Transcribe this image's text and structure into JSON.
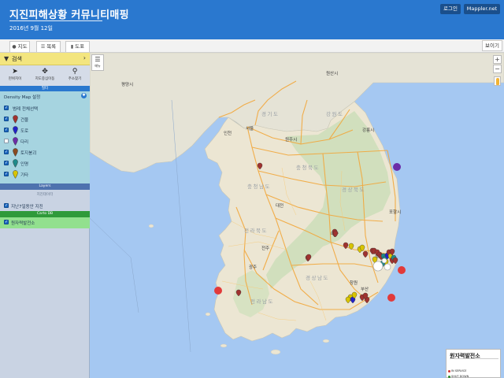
{
  "header": {
    "title": "지진피해상황 커뮤니티매핑",
    "date": "2016년 9월 12일",
    "login_label": "로그인",
    "brand_label": "Mappler.net"
  },
  "tabs": [
    {
      "label": "지도",
      "icon": "map-marker-icon"
    },
    {
      "label": "목록",
      "icon": "list-icon"
    },
    {
      "label": "도표",
      "icon": "bar-chart-icon"
    }
  ],
  "view_label": "보이기",
  "sidebar": {
    "search_label": "검색",
    "tools": [
      {
        "label": "현위치이",
        "icon": "locate-arrow-icon"
      },
      {
        "label": "지도중심이동",
        "icon": "crosshair-icon"
      },
      {
        "label": "주소찾기",
        "icon": "magnifier-icon"
      }
    ],
    "section_label": "필터",
    "density_label": "Density Map 설정",
    "categories": [
      {
        "label": "범례 전체선택",
        "checked": true,
        "color": null
      },
      {
        "label": "건물",
        "checked": true,
        "color": "#a0322f"
      },
      {
        "label": "도로",
        "checked": true,
        "color": "#2222c8"
      },
      {
        "label": "다리",
        "checked": false,
        "color": "#6b2ca8"
      },
      {
        "label": "토지붕괴",
        "checked": true,
        "color": "#8a4a20"
      },
      {
        "label": "인명",
        "checked": true,
        "color": "#1f8a8a"
      },
      {
        "label": "기타",
        "checked": true,
        "color": "#d8c400"
      }
    ],
    "layers_label": "Layers",
    "layers_sub": "지진데이터",
    "layer_item": "지난7일동안 지진",
    "carto_label": "Carto DB",
    "carto_item": "원자력발전소"
  },
  "map": {
    "menu_label": "메뉴",
    "zoom_in": "+",
    "zoom_out": "−",
    "labels": [
      {
        "text": "평양시",
        "kind": "city"
      },
      {
        "text": "원산시",
        "kind": "city"
      },
      {
        "text": "서울",
        "kind": "city"
      },
      {
        "text": "인천",
        "kind": "city"
      },
      {
        "text": "경기도",
        "kind": "province"
      },
      {
        "text": "강원도",
        "kind": "province"
      },
      {
        "text": "충청북도",
        "kind": "province"
      },
      {
        "text": "충청남도",
        "kind": "province"
      },
      {
        "text": "대전",
        "kind": "city"
      },
      {
        "text": "경상북도",
        "kind": "province"
      },
      {
        "text": "전라북도",
        "kind": "province"
      },
      {
        "text": "대구",
        "kind": "city"
      },
      {
        "text": "광주",
        "kind": "city"
      },
      {
        "text": "울산",
        "kind": "city"
      },
      {
        "text": "경상남도",
        "kind": "province"
      },
      {
        "text": "부산",
        "kind": "city"
      },
      {
        "text": "전라남도",
        "kind": "province"
      },
      {
        "text": "강릉시",
        "kind": "city"
      },
      {
        "text": "원주시",
        "kind": "city"
      },
      {
        "text": "포항시",
        "kind": "city"
      },
      {
        "text": "전주",
        "kind": "city"
      },
      {
        "text": "창원",
        "kind": "city"
      }
    ]
  },
  "legend": {
    "title": "원자력발전소",
    "items": [
      {
        "label": "IN SERVICE",
        "color": "#d03030"
      },
      {
        "label": "SHUT DOWN",
        "color": "#2a8a2a"
      }
    ]
  }
}
